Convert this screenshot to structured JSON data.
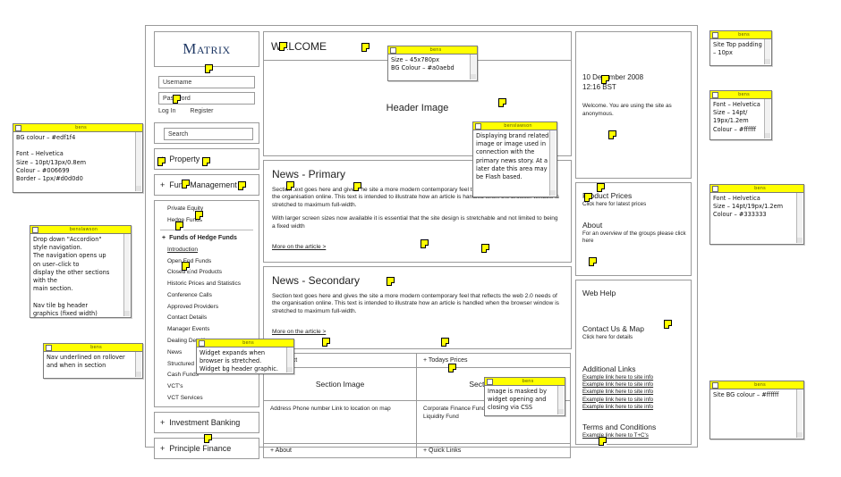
{
  "site": {
    "logo": "Matrix",
    "login": {
      "username_placeholder": "Username",
      "password_placeholder": "Password",
      "login_label": "Log In",
      "register_label": "Register"
    },
    "search": {
      "placeholder": "Search"
    },
    "nav": [
      {
        "label": "Property",
        "expander": "+"
      },
      {
        "label": "Fund Management",
        "expander": "+"
      }
    ],
    "fund_management_items": [
      "Private Equity",
      "Hedge Funds"
    ],
    "funds_of_hedge_funds": {
      "label": "Funds of Hedge Funds",
      "expander": "+",
      "items": [
        "Introduction",
        "Open End Funds",
        "Closed End Products",
        "Historic Prices and Statistics",
        "Conference Calls",
        "Approved Providers",
        "Contact Details",
        "Manager Events",
        "Dealing Deadlines",
        "News",
        "Structured Products",
        "Cash Funds",
        "VCT's",
        "VCT Services"
      ]
    },
    "nav_bottom": [
      {
        "label": "Investment Banking",
        "expander": "+"
      },
      {
        "label": "Principle Finance",
        "expander": "+"
      }
    ],
    "welcome_bar": "WELCOME",
    "hero_label": "Header Image",
    "news_primary": {
      "title": "News - Primary",
      "para1": "Section text goes here and gives the site a more modern contemporary feel that reflects the web 2.0 needs of the organisation online. This text is intended to illustrate how an article is handled when the browser window is stretched to maximum full-width.",
      "para2": "With larger screen sizes now available it is essential that the site design is stretchable and not limited to being a fixed width",
      "more": "More on the article >"
    },
    "news_secondary": {
      "title": "News - Secondary",
      "para1": "Section text goes here and gives the site a more modern contemporary feel that reflects the web 2.0 needs of the organisation online. This text is intended to illustrate how an article is handled when the browser window is stretched to maximum full-width.",
      "more": "More on the article >"
    },
    "widgets": [
      {
        "header": "+ Contact",
        "image_label": "Section Image",
        "body": "Address\nPhone number\nLink to location on map",
        "footer": "+ About"
      },
      {
        "header": "+ Todays Prices",
        "image_label": "Section Image",
        "body": "Corporate Finance\nFunds of Hedge Funds\nPrime Rate Liquidity Fund",
        "footer": "+ Quick Links"
      }
    ],
    "right": {
      "date": "10 December 2008",
      "time": "12:16 BST",
      "welcome_text": "Welcome. You are using the site as anonymous.",
      "blocks": [
        {
          "title": "Product Prices",
          "sub": "Click here for latest prices"
        },
        {
          "title": "About",
          "sub": "For an overview of the groups please click here"
        },
        {
          "title": "Web Help",
          "sub": ""
        },
        {
          "title": "Contact Us & Map",
          "sub": "Click here for details"
        }
      ],
      "additional_links_title": "Additional Links",
      "additional_links": [
        "Example link here to site info",
        "Example link here to site info",
        "Example link here to site info",
        "Example link here to site info",
        "Example link here to site info"
      ],
      "terms_title": "Terms and Conditions",
      "terms_link": "Example link here to T+C's"
    }
  },
  "notes": [
    {
      "id": "note-nav-style",
      "author": "bens",
      "text": "BG colour – #edf1f4\n\nFont – Helvetica\nSize – 10pt/13px/0.8em\nColour – #006699\nBorder – 1px/#d0d0d0"
    },
    {
      "id": "note-accordion",
      "author": "benslawson",
      "text": "Drop down \"Accordion\"\nstyle navigation.\nThe navigation opens up\non user–click to\ndisplay the other sections\nwith the\nmain section.\n\nNav tile bg header\ngraphics (fixed width)"
    },
    {
      "id": "note-nav-rollover",
      "author": "bens",
      "text": "Nav underlined on rollover\nand when in section"
    },
    {
      "id": "note-header-size",
      "author": "bens",
      "text": "Size – 45x780px\nBG Colour – #a0aebd"
    },
    {
      "id": "note-hero-image",
      "author": "benslawson",
      "text": "Displaying brand related\nimage or image used in\nconnection with the\nprimary news story. At a\nlater date this area may\nbe Flash based."
    },
    {
      "id": "note-widget-expand",
      "author": "bens",
      "text": "Widget expands when\nbrowser is stretched.\nWidget bg header graphic."
    },
    {
      "id": "note-image-mask",
      "author": "bens",
      "text": "Image is masked by\nwidget opening and\nclosing via CSS"
    },
    {
      "id": "note-top-padding",
      "author": "bens",
      "text": "Site Top padding\n– 10px"
    },
    {
      "id": "note-font-white",
      "author": "bens",
      "text": "Font – Helvetica\nSize – 14pt/\n19px/1.2em\nColour – #ffffff"
    },
    {
      "id": "note-font-dark",
      "author": "bens",
      "text": "Font – Helvetica\nSize – 14pt/19px/1.2em\nColour – #333333"
    },
    {
      "id": "note-site-bg",
      "author": "bens",
      "text": "Site BG colour – #ffffff"
    }
  ],
  "colors": {
    "note_header": "#ffff00",
    "logo": "#1f3864",
    "frame_border": "#9a9a9a"
  }
}
